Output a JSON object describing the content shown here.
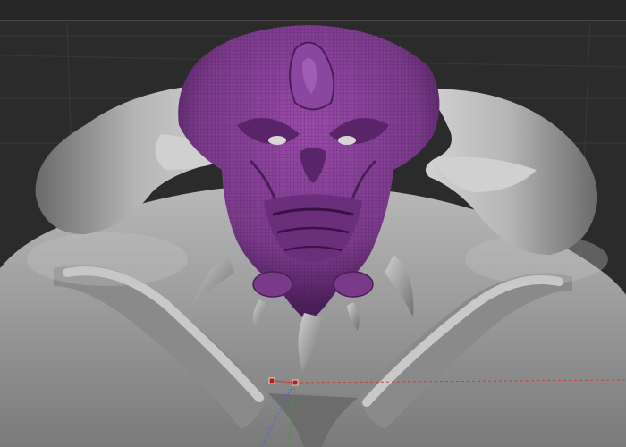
{
  "viewport": {
    "colors": {
      "background": "#2b2b2b",
      "grid": "#3a3a3a",
      "clay": "#9e9e9e",
      "clay_light": "#c9c9c9",
      "clay_dark": "#5e5e5e",
      "masked_purple": "#7a3a8a",
      "masked_purple_dark": "#4a1e58",
      "axis_red": "#c83c3c",
      "axis_green": "#3c9a3c",
      "axis_blue": "#4a6ad0",
      "pivot_marker": "#b02020"
    },
    "model": {
      "head_state": "masked",
      "icon": "sculpt-model-icon"
    },
    "gizmo": {
      "markers": 2
    }
  }
}
